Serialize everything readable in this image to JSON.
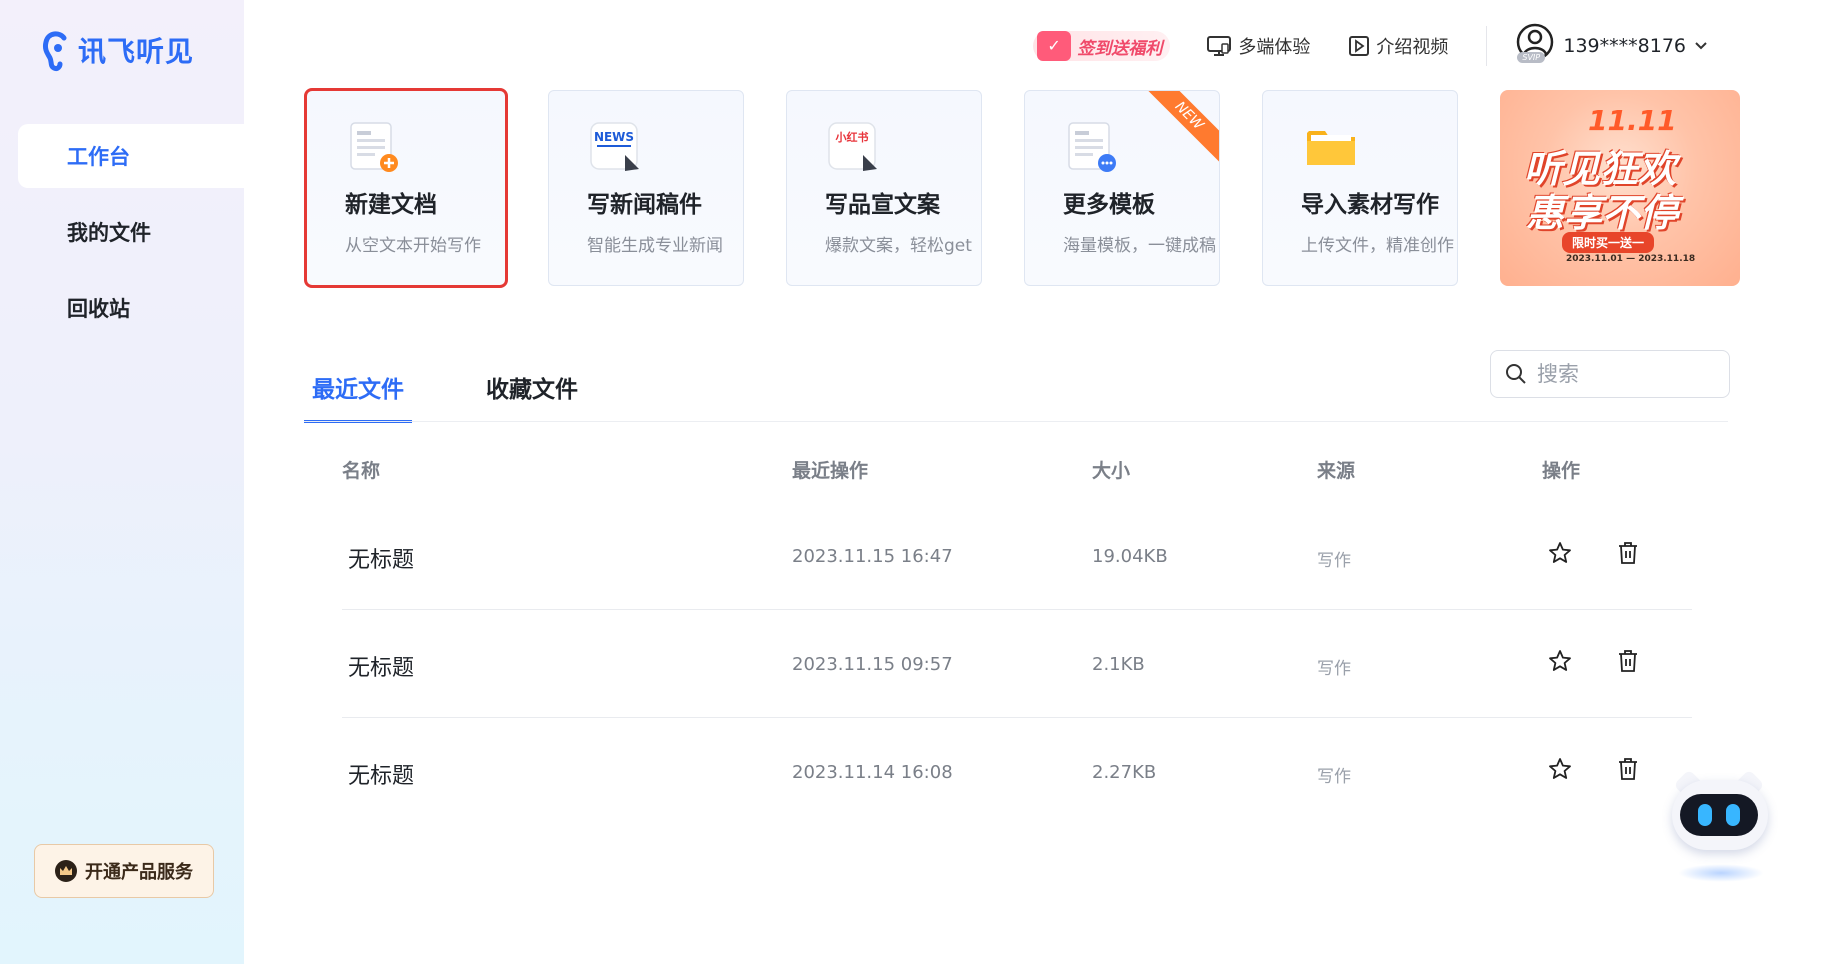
{
  "sidebar": {
    "logo_text": "讯飞听见",
    "items": [
      {
        "label": "工作台",
        "active": true
      },
      {
        "label": "我的文件",
        "active": false
      },
      {
        "label": "回收站",
        "active": false
      }
    ],
    "subscribe_label": "开通产品服务"
  },
  "header": {
    "sign_in_label": "签到送福利",
    "multi_device_label": "多端体验",
    "intro_video_label": "介绍视频",
    "user_phone": "139****8176",
    "vip_badge": "SVIP"
  },
  "cards": [
    {
      "title": "新建文档",
      "desc": "从空文本开始写作",
      "icon": "new-doc-icon"
    },
    {
      "title": "写新闻稿件",
      "desc": "智能生成专业新闻",
      "icon": "news-icon",
      "icon_text": "NEWS"
    },
    {
      "title": "写品宣文案",
      "desc": "爆款文案，轻松get",
      "icon": "xiaohongshu-icon",
      "icon_text": "小红书"
    },
    {
      "title": "更多模板",
      "desc": "海量模板，一键成稿",
      "icon": "template-icon",
      "badge": "NEW"
    },
    {
      "title": "导入素材写作",
      "desc": "上传文件，精准创作",
      "icon": "folder-icon"
    }
  ],
  "banner": {
    "date_title": "11.11",
    "line1": "听见狂欢",
    "line2": "惠享不停",
    "promo": "限时买一送一",
    "period": "2023.11.01 — 2023.11.18"
  },
  "tabs": [
    {
      "label": "最近文件",
      "active": true
    },
    {
      "label": "收藏文件",
      "active": false
    }
  ],
  "search": {
    "placeholder": "搜索"
  },
  "table": {
    "headers": [
      "名称",
      "最近操作",
      "大小",
      "来源",
      "操作"
    ],
    "rows": [
      {
        "name": "无标题",
        "time": "2023.11.15 16:47",
        "size": "19.04KB",
        "source": "写作"
      },
      {
        "name": "无标题",
        "time": "2023.11.15 09:57",
        "size": "2.1KB",
        "source": "写作"
      },
      {
        "name": "无标题",
        "time": "2023.11.14 16:08",
        "size": "2.27KB",
        "source": "写作"
      }
    ]
  },
  "colors": {
    "accent": "#2d6cf6",
    "highlight_box": "#e53935",
    "sign_in": "#f04a6a"
  }
}
